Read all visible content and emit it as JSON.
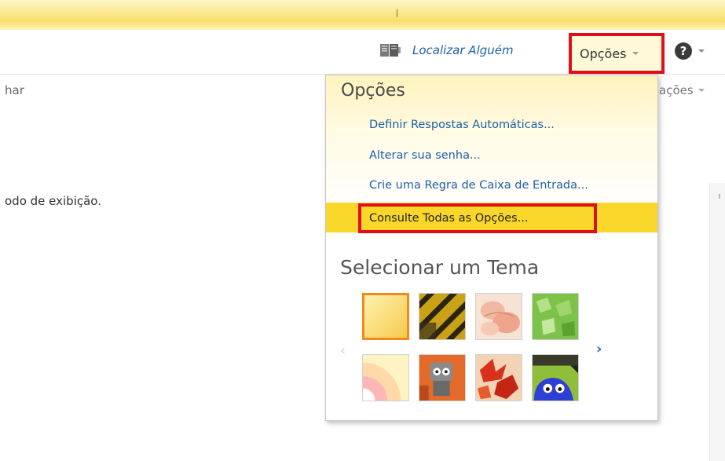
{
  "header": {
    "find_person": "Localizar Alguém",
    "options_label": "Opções"
  },
  "background": {
    "left_fragment": "har",
    "right_fragment": "ações",
    "view_text": "odo de exibição."
  },
  "menu": {
    "title": "Opções",
    "items": [
      "Definir Respostas Automáticas...",
      "Alterar sua senha...",
      "Crie uma Regra de Caixa de Entrada...",
      "Consulte Todas as Opções..."
    ],
    "theme_title": "Selecionar um Tema",
    "themes": [
      {
        "name": "yellow-theme",
        "selected": true
      },
      {
        "name": "hazard-stripes-theme",
        "selected": false
      },
      {
        "name": "pink-flower-theme",
        "selected": false
      },
      {
        "name": "green-leaves-theme",
        "selected": false
      },
      {
        "name": "sunburst-theme",
        "selected": false
      },
      {
        "name": "robot-theme",
        "selected": false
      },
      {
        "name": "autumn-leaves-theme",
        "selected": false
      },
      {
        "name": "blue-monster-theme",
        "selected": false
      }
    ]
  },
  "colors": {
    "accent_red": "#e0101a",
    "highlight_yellow": "#f9d62a",
    "link_blue": "#1e5fa8",
    "selected_orange": "#f08a1c"
  }
}
